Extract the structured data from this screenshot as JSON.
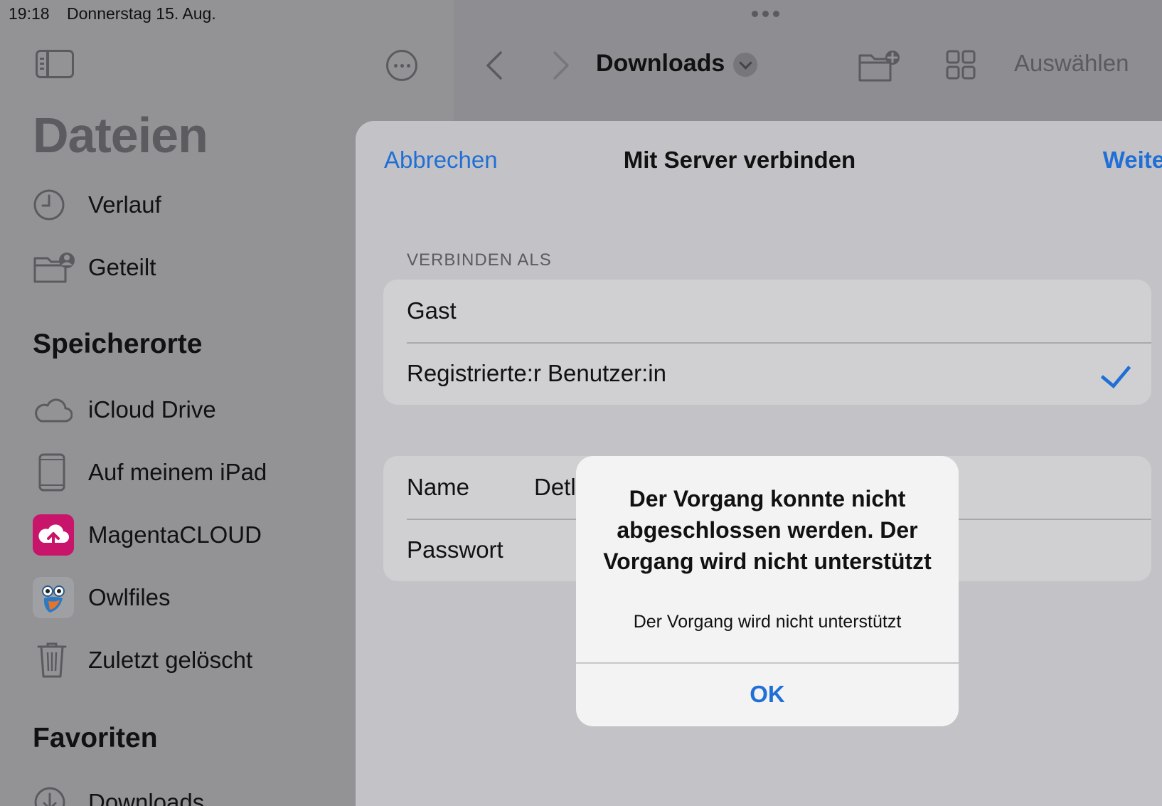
{
  "status": {
    "time": "19:18",
    "date": "Donnerstag 15. Aug."
  },
  "sidebar": {
    "title": "Dateien",
    "items_top": [
      {
        "label": "Verlauf",
        "icon": "clock-icon"
      },
      {
        "label": "Geteilt",
        "icon": "shared-folder-icon"
      }
    ],
    "section_locations": "Speicherorte",
    "locations": [
      {
        "label": "iCloud Drive",
        "icon": "cloud-icon"
      },
      {
        "label": "Auf meinem iPad",
        "icon": "ipad-icon"
      },
      {
        "label": "MagentaCLOUD",
        "icon": "magentacloud-icon"
      },
      {
        "label": "Owlfiles",
        "icon": "owlfiles-icon"
      },
      {
        "label": "Zuletzt gelöscht",
        "icon": "trash-icon"
      }
    ],
    "section_favorites": "Favoriten",
    "favorites": [
      {
        "label": "Downloads",
        "icon": "download-icon"
      }
    ]
  },
  "toolbar": {
    "title": "Downloads",
    "select_label": "Auswählen"
  },
  "sheet": {
    "cancel_label": "Abbrechen",
    "title": "Mit Server verbinden",
    "next_label": "Weiter",
    "connect_as_label": "VERBINDEN ALS",
    "options": [
      {
        "label": "Gast"
      },
      {
        "label": "Registrierte:r Benutzer:in",
        "selected": true
      }
    ],
    "fields": [
      {
        "label": "Name",
        "value": "Detl"
      },
      {
        "label": "Passwort",
        "value": ""
      }
    ]
  },
  "alert": {
    "title": "Der Vorgang konnte nicht abgeschlossen werden. Der Vorgang wird nicht unterstützt",
    "message": "Der Vorgang wird nicht unterstützt",
    "ok_label": "OK"
  },
  "colors": {
    "accent": "#1f6fd6",
    "magenta": "#e20074"
  }
}
